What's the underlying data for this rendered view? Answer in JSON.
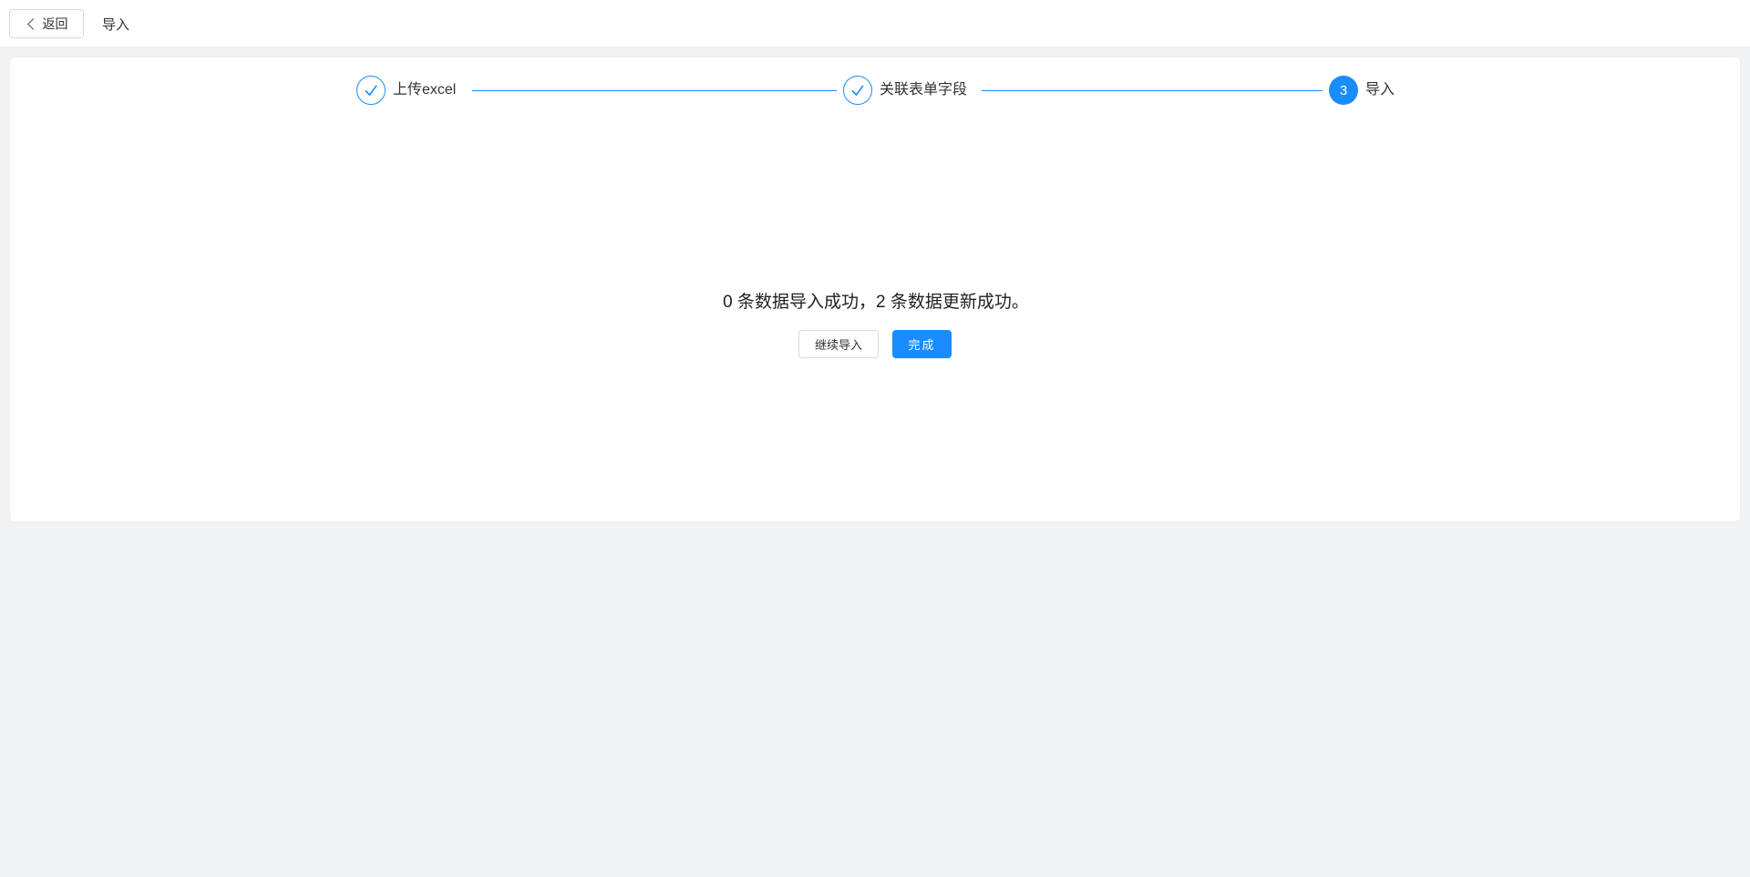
{
  "header": {
    "back_label": "返回",
    "title": "导入"
  },
  "steps": [
    {
      "label": "上传excel",
      "status": "done",
      "icon": "check-icon"
    },
    {
      "label": "关联表单字段",
      "status": "done",
      "icon": "check-icon"
    },
    {
      "label": "导入",
      "status": "active",
      "number": "3"
    }
  ],
  "result": {
    "message": "0 条数据导入成功，2 条数据更新成功。",
    "continue_label": "继续导入",
    "done_label": "完成"
  },
  "colors": {
    "accent": "#1a8cff",
    "background": "#f2f3f5"
  }
}
